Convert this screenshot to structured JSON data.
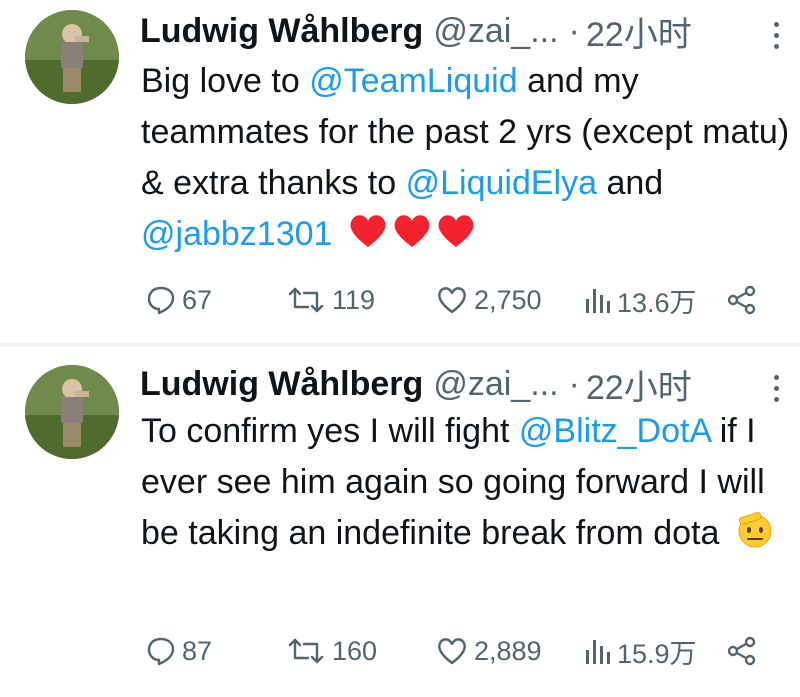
{
  "tweets": [
    {
      "author_name": "Ludwig Wåhlberg",
      "author_handle": "@zai_...",
      "separator": "·",
      "time": "22小时",
      "text": {
        "p1": "Big love to ",
        "m1": "@TeamLiquid",
        "p2": " and my teammates for the past 2 yrs (except matu) & extra thanks to ",
        "m2": "@LiquidElya",
        "p3": " and ",
        "m3": "@jabbz1301",
        "emoji": "❤️❤️❤️"
      },
      "stats": {
        "replies": "67",
        "retweets": "119",
        "likes": "2,750",
        "views": "13.6万"
      }
    },
    {
      "author_name": "Ludwig Wåhlberg",
      "author_handle": "@zai_...",
      "separator": "·",
      "time": "22小时",
      "text": {
        "p1": "To confirm yes I will fight ",
        "m1": "@Blitz_DotA",
        "p2": " if I ever see him again so going forward I will be taking an indefinite break from dota",
        "emoji": "🫡"
      },
      "stats": {
        "replies": "87",
        "retweets": "160",
        "likes": "2,889",
        "views": "15.9万"
      }
    }
  ],
  "colors": {
    "text": "#0f1419",
    "secondary": "#536471",
    "mention": "#1d9bf0",
    "heart": "#f4212e"
  },
  "icons": [
    "reply-icon",
    "retweet-icon",
    "like-icon",
    "views-icon",
    "share-icon",
    "more-icon"
  ]
}
